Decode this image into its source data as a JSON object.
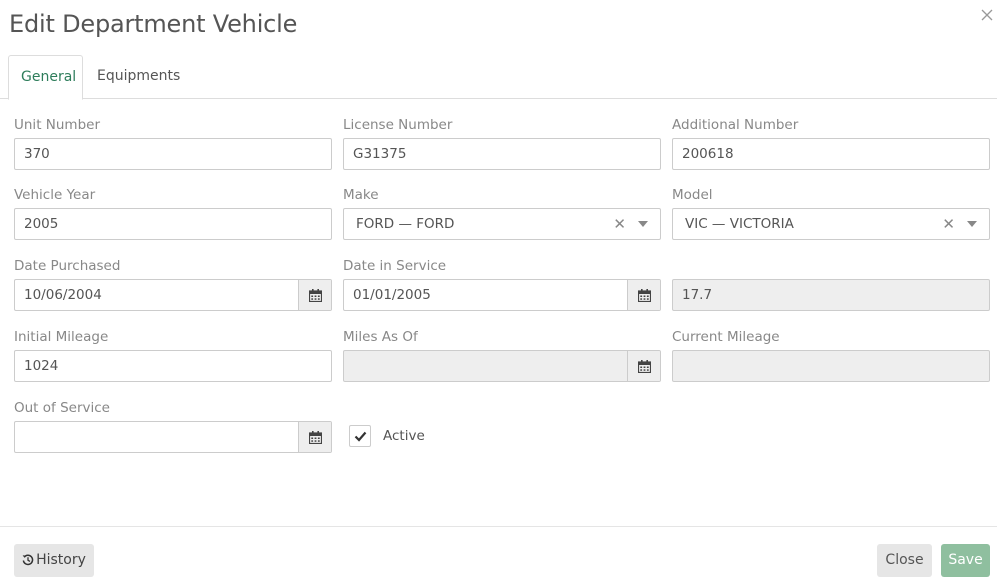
{
  "modal": {
    "title": "Edit Department Vehicle",
    "close_icon": "close-icon"
  },
  "tabs": [
    {
      "label": "General",
      "active": true
    },
    {
      "label": "Equipments",
      "active": false
    }
  ],
  "form": {
    "unit_number": {
      "label": "Unit Number",
      "value": "370"
    },
    "license_number": {
      "label": "License Number",
      "value": "G31375"
    },
    "additional_number": {
      "label": "Additional Number",
      "value": "200618"
    },
    "vehicle_year": {
      "label": "Vehicle Year",
      "value": "2005"
    },
    "make": {
      "label": "Make",
      "value": "FORD — FORD"
    },
    "model": {
      "label": "Model",
      "value": "VIC — VICTORIA"
    },
    "date_purchased": {
      "label": "Date Purchased",
      "value": "10/06/2004"
    },
    "date_in_service": {
      "label": "Date in Service",
      "value": "01/01/2005"
    },
    "age": {
      "value": "17.7"
    },
    "initial_mileage": {
      "label": "Initial Mileage",
      "value": "1024"
    },
    "miles_as_of": {
      "label": "Miles As Of",
      "value": ""
    },
    "current_mileage": {
      "label": "Current Mileage",
      "value": ""
    },
    "out_of_service": {
      "label": "Out of Service",
      "value": ""
    },
    "active": {
      "label": "Active",
      "checked": true
    }
  },
  "footer": {
    "history_label": "History",
    "close_label": "Close",
    "save_label": "Save"
  },
  "colors": {
    "accent": "#2e7d5b",
    "save_button": "#8fbf9f"
  }
}
